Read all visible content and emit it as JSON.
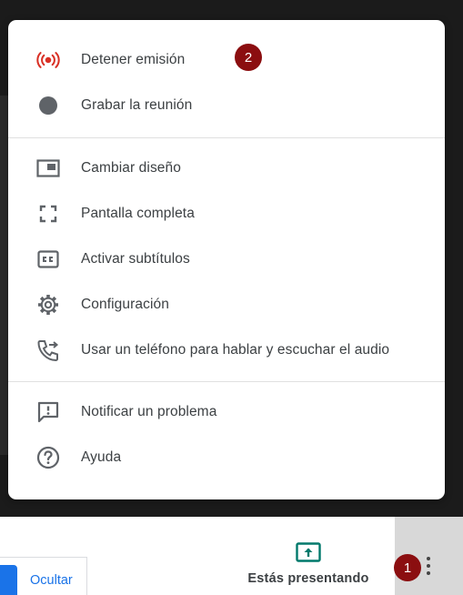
{
  "menu": {
    "items": [
      {
        "label": "Detener emisión",
        "icon": "broadcast-icon"
      },
      {
        "label": "Grabar la reunión",
        "icon": "record-icon"
      },
      {
        "label": "Cambiar diseño",
        "icon": "layout-icon"
      },
      {
        "label": "Pantalla completa",
        "icon": "fullscreen-icon"
      },
      {
        "label": "Activar subtítulos",
        "icon": "closed-captions-icon"
      },
      {
        "label": "Configuración",
        "icon": "gear-icon"
      },
      {
        "label": "Usar un teléfono para hablar y escuchar el audio",
        "icon": "phone-forward-icon"
      },
      {
        "label": "Notificar un problema",
        "icon": "report-problem-icon"
      },
      {
        "label": "Ayuda",
        "icon": "help-icon"
      }
    ]
  },
  "badges": {
    "first": "1",
    "second": "2"
  },
  "bottombar": {
    "presenting_label": "Estás presentando",
    "hide_label": "Ocultar"
  },
  "colors": {
    "broadcast_red": "#d93025",
    "badge": "#8b0e10",
    "present_teal": "#00796b",
    "link_blue": "#1a73e8",
    "icon_gray": "#5f6368"
  }
}
